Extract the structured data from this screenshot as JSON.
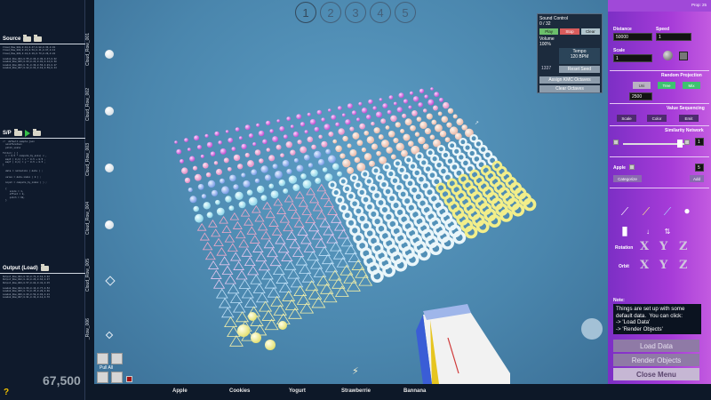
{
  "left_panel": {
    "source": {
      "title": "Source",
      "lines": [
        "Cloud_Row_001,0.12,0.47,0.88,0.33,0.91",
        "Cloud_Row_002,0.21,0.58,0.41,0.67,0.12",
        "Cloud_Row_003,0.44,0.19,0.73,0.29,0.81",
        "",
        "Loaded_Row_004,0.55,0.86,0.30,0.47,0.62",
        "Loaded_Row_005,0.63,0.22,0.91,0.14,0.38",
        "Loaded_Row_006,0.71,0.39,0.56,0.83,0.27",
        "Loaded_Row_007,0.82,0.64,0.18,0.59,0.44"
      ]
    },
    "sp": {
      "title": "S/P",
      "lines": [
        "//  default.sample.json",
        "  sonification  ",
        "  pitch_scale  ",
        "",
        "filter( ) {",
        "  x = 0.5 * compute_by_axis( x ,",
        "  mapX ( 0,1) = x * 0.5 + 0.5 ,",
        "  mapY ( 0,1) = y * 0.5 + 0.5 ,",
        "}",
        "",
        "  data = normalize ( data ) ;",
        "",
        "  value = data.index ( 0 ) ;",
        "",
        "  input = compute_by_index ( ) ;",
        "",
        "  {",
        "     scale = 1,",
        "     offset = 0,",
        "     pitch = 60,",
        "  }"
      ]
    },
    "output": {
      "title": "Output (Load)",
      "lines": [
        "Output_Row_001,0.33,0.71,0.18,0.92",
        "Output_Row_002,0.48,0.26,0.64,0.37",
        "Output_Row_003,0.57,0.82,0.41,0.15",
        "",
        "Loaded_Row_004,0.69,0.13,0.77,0.52",
        "Loaded_Row_005,0.74,0.45,0.29,0.68",
        "Loaded_Row_006,0.86,0.58,0.93,0.21",
        "Loaded_Row_007,0.91,0.34,0.12,0.76"
      ]
    }
  },
  "cloud_rows": [
    "Cloud_Row_001",
    "Cloud_Row_002",
    "Cloud_Row_003",
    "Cloud_Row_004",
    "Cloud_Row_005",
    "_Row_006"
  ],
  "pages": [
    "1",
    "2",
    "3",
    "4",
    "5"
  ],
  "sound_control": {
    "title": "Sound Control",
    "counter": "0 / 32",
    "play": "Play",
    "stop": "Stop",
    "clear": "Clear",
    "volume_label": "Volume",
    "volume_value": "100%",
    "tempo_label": "Tempo",
    "tempo_value": "120 BPM",
    "side_number": "1337",
    "reset_seed": "Reset Seed",
    "assign_octaves": "Assign KMC Octaves",
    "clear_octaves": "Clear Octaves"
  },
  "right_panel": {
    "prop_label": "Prop: 25",
    "distance_label": "Distance",
    "distance_value": "50000",
    "speed_label": "Speed",
    "speed_value": "1",
    "scale_label": "Scale",
    "scale_value": "1",
    "random_projection": "Random Projection",
    "rp_btn1": "Uni",
    "rp_btn2": "Tree",
    "rp_btn3": "Mix",
    "rp_value": "2500",
    "value_sequencing": "Value Sequencing",
    "vs_scale": "Scale",
    "vs_color": "Color",
    "vs_emit": "Emit",
    "similarity_network": "Similarity Network",
    "sim_value": "1",
    "apple_label": "Apple",
    "apple_value": "5",
    "apple_btn": "Categorize",
    "apple_btn2": "Add",
    "rotation_label": "Rotation",
    "orbit_label": "Orbit",
    "rotation_glyphs": [
      "X",
      "Y",
      "Z"
    ],
    "orbit_glyphs": [
      "X",
      "Y",
      "Z"
    ],
    "note_label": "Note:",
    "note_text": "Things are set up with some\ndefault data.  You can click:\n-> 'Load Data'\n-> 'Render Objects'",
    "load_data": "Load Data",
    "render_objects": "Render Objects",
    "close_menu": "Close Menu"
  },
  "bottom_bar": {
    "items": [
      "Apple",
      "Cookies",
      "Yogurt",
      "Strawberrie",
      "Bannana"
    ]
  },
  "pull_all": "Pull All",
  "count": "67,500",
  "help": "?",
  "colors": {
    "accent": "#a63bd8",
    "viewport": "#4a86ad",
    "panel": "#0f1a2c"
  }
}
